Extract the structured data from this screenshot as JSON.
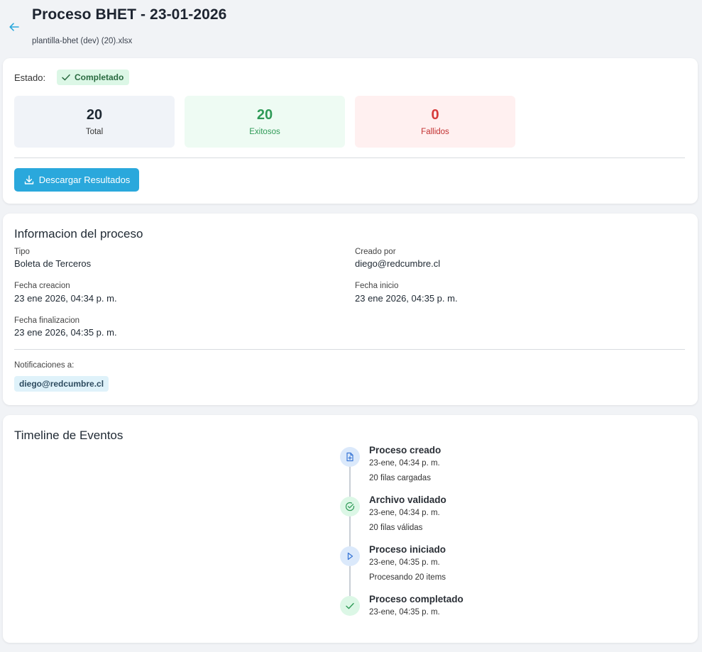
{
  "header": {
    "title": "Proceso BHET - 23-01-2026",
    "filename": "plantilla-bhet (dev) (20).xlsx"
  },
  "status": {
    "label": "Estado:",
    "badge": "Completado",
    "stats": {
      "total": {
        "value": "20",
        "label": "Total"
      },
      "success": {
        "value": "20",
        "label": "Exitosos"
      },
      "failed": {
        "value": "0",
        "label": "Fallidos"
      }
    },
    "download_label": "Descargar Resultados"
  },
  "info": {
    "title": "Informacion del proceso",
    "tipo": {
      "label": "Tipo",
      "value": "Boleta de Terceros"
    },
    "creado_por": {
      "label": "Creado por",
      "value": "diego@redcumbre.cl"
    },
    "fecha_creacion": {
      "label": "Fecha creacion",
      "value": "23 ene 2026, 04:34 p. m."
    },
    "fecha_inicio": {
      "label": "Fecha inicio",
      "value": "23 ene 2026, 04:35 p. m."
    },
    "fecha_finalizacion": {
      "label": "Fecha finalizacion",
      "value": "23 ene 2026, 04:35 p. m."
    },
    "notificaciones_label": "Notificaciones a:",
    "notificaciones_email": "diego@redcumbre.cl"
  },
  "timeline": {
    "title": "Timeline de Eventos",
    "events": [
      {
        "title": "Proceso creado",
        "date": "23-ene, 04:34 p. m.",
        "detail": "20 filas cargadas",
        "icon": "file-plus-icon"
      },
      {
        "title": "Archivo validado",
        "date": "23-ene, 04:34 p. m.",
        "detail": "20 filas válidas",
        "icon": "check-circle-icon"
      },
      {
        "title": "Proceso iniciado",
        "date": "23-ene, 04:35 p. m.",
        "detail": "Procesando 20 items",
        "icon": "play-icon"
      },
      {
        "title": "Proceso completado",
        "date": "23-ene, 04:35 p. m.",
        "detail": "",
        "icon": "check-icon"
      }
    ]
  },
  "colors": {
    "accent": "#2aa8dc",
    "success": "#2f9a57",
    "danger": "#d63a3a"
  }
}
